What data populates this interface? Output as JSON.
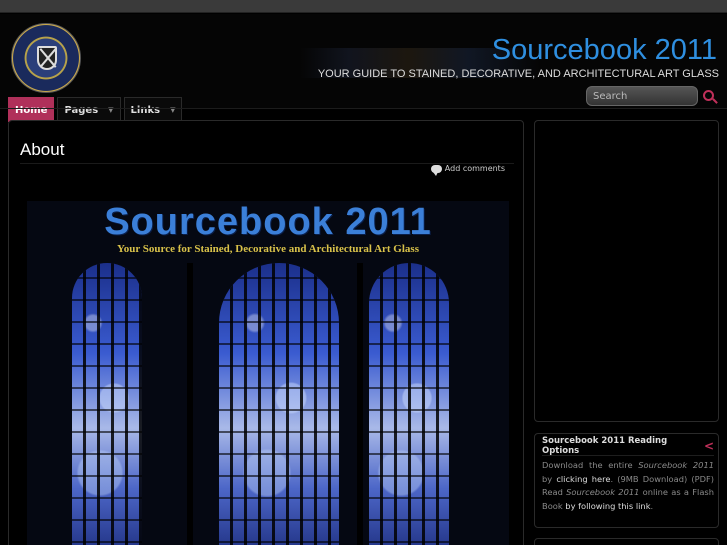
{
  "header": {
    "title": "Sourcebook 2011",
    "tagline": "YOUR GUIDE TO STAINED, DECORATIVE, AND ARCHITECTURAL ART GLASS"
  },
  "nav": {
    "items": [
      {
        "label": "Home"
      },
      {
        "label": "Pages"
      },
      {
        "label": "Links"
      }
    ]
  },
  "search": {
    "placeholder": "Search"
  },
  "post": {
    "title": "About",
    "comments_link": "Add comments",
    "cover": {
      "title": "Sourcebook 2011",
      "subtitle": "Your Source for Stained, Decorative and Architectural Art Glass"
    }
  },
  "sidebar": {
    "widget": {
      "title": "Sourcebook 2011 Reading Options",
      "toggle": "<",
      "text1": "Download the entire ",
      "em1": "Sourcebook 2011",
      "text2": " by ",
      "link1": "clicking here",
      "text3": ". (9MB Download) (PDF) Read ",
      "em2": "Sourcebook 2011",
      "text4": " online as a Flash Book ",
      "link2": "by following this link",
      "text5": "."
    }
  },
  "colors": {
    "accent": "#b0305a",
    "title_blue": "#2f8fe0"
  }
}
